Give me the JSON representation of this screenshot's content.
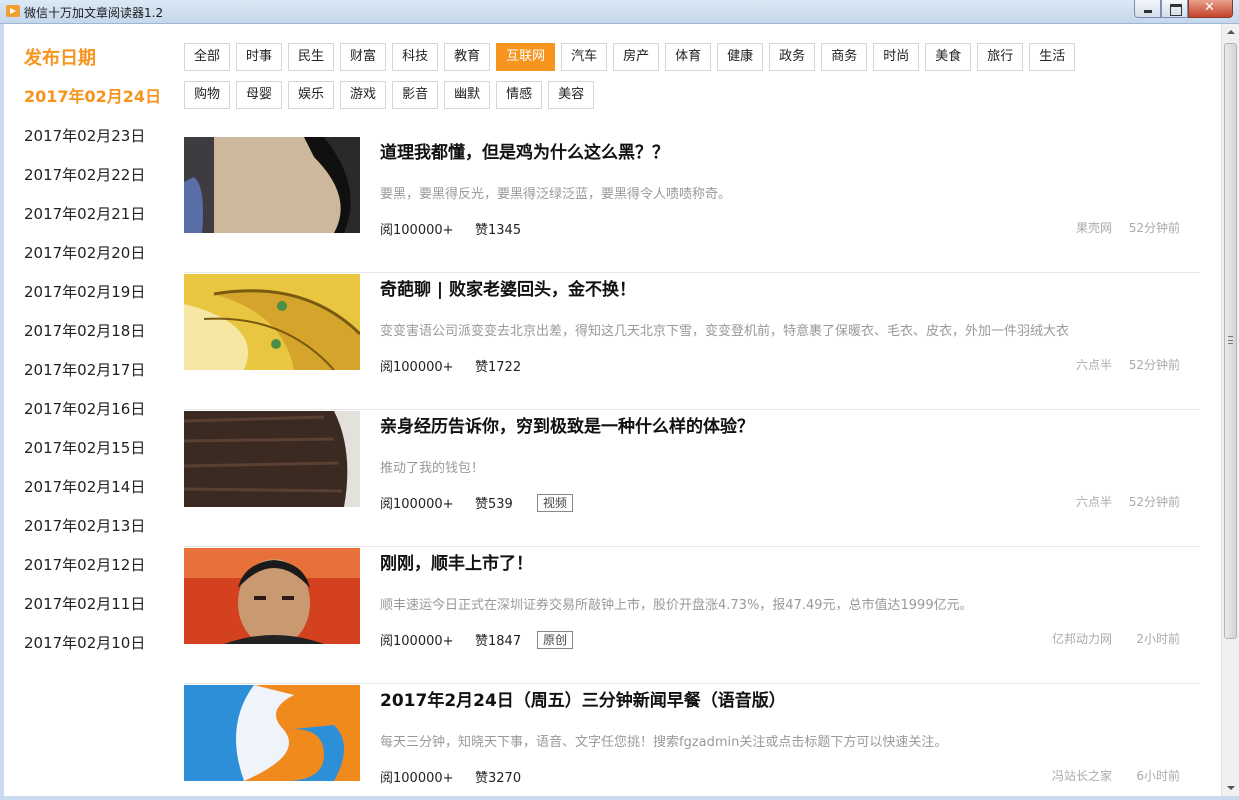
{
  "window": {
    "title": "微信十万加文章阅读器1.2"
  },
  "sidebar": {
    "heading": "发布日期",
    "dates": [
      "2017年02月24日",
      "2017年02月23日",
      "2017年02月22日",
      "2017年02月21日",
      "2017年02月20日",
      "2017年02月19日",
      "2017年02月18日",
      "2017年02月17日",
      "2017年02月16日",
      "2017年02月15日",
      "2017年02月14日",
      "2017年02月13日",
      "2017年02月12日",
      "2017年02月11日",
      "2017年02月10日"
    ],
    "active_date": "2017年02月24日"
  },
  "categories": {
    "row1": [
      "全部",
      "时事",
      "民生",
      "财富",
      "科技",
      "教育",
      "互联网",
      "汽车",
      "房产",
      "体育",
      "健康",
      "政务",
      "商务",
      "时尚",
      "美食",
      "旅行",
      "生活"
    ],
    "row2": [
      "购物",
      "母婴",
      "娱乐",
      "游戏",
      "影音",
      "幽默",
      "情感",
      "美容"
    ],
    "active": "互联网"
  },
  "articles": [
    {
      "title": "道理我都懂，但是鸡为什么这么黑？？",
      "summary": "要黑，要黑得反光，要黑得泛绿泛蓝，要黑得令人啧啧称奇。",
      "reads": "阅100000+",
      "likes": "赞1345",
      "tag": "",
      "source": "果壳网",
      "time": "52分钟前",
      "thumb": "bird-photo"
    },
    {
      "title": "奇葩聊 | 败家老婆回头，金不换！",
      "summary": "变变害语公司派变变去北京出差，得知这几天北京下雪，变变登机前，特意裹了保暖衣、毛衣、皮衣，外加一件羽绒大衣",
      "reads": "阅100000+",
      "likes": "赞1722",
      "tag": "",
      "source": "六点半",
      "time": "52分钟前",
      "thumb": "gold-cartoon"
    },
    {
      "title": "亲身经历告诉你，穷到极致是一种什么样的体验？",
      "summary": "推动了我的钱包！",
      "reads": "阅100000+",
      "likes": "赞539",
      "tag": "视频",
      "source": "六点半",
      "time": "52分钟前",
      "thumb": "hair-photo"
    },
    {
      "title": "刚刚，顺丰上市了！",
      "summary": "顺丰速运今日正式在深圳证券交易所敲钟上市，股价开盘涨4.73%，报47.49元，总市值达1999亿元。",
      "reads": "阅100000+",
      "likes": "赞1847",
      "tag": "原创",
      "source": "亿邦动力网",
      "time": "2小时前",
      "thumb": "man-portrait"
    },
    {
      "title": "2017年2月24日（周五）三分钟新闻早餐（语音版）",
      "summary": "每天三分钟，知晓天下事，语音、文字任您挑！搜索fgzadmin关注或点击标题下方可以快速关注。",
      "reads": "阅100000+",
      "likes": "赞3270",
      "tag": "",
      "source": "冯站长之家",
      "time": "6小时前",
      "thumb": "blue-orange-logo"
    }
  ]
}
